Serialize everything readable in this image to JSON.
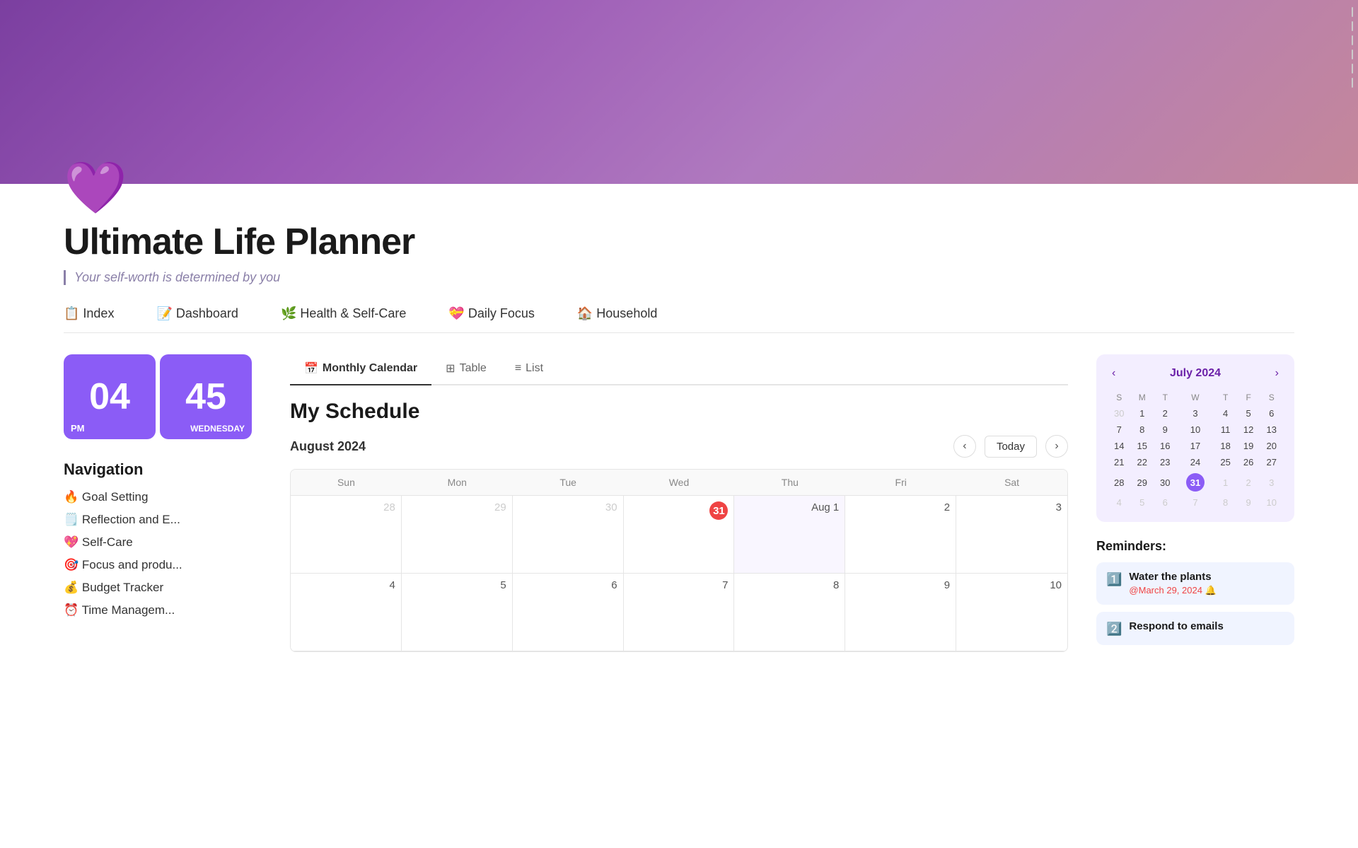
{
  "app": {
    "title": "Ultimate Life Planner",
    "subtitle": "Your self-worth is determined by you",
    "heart_emoji": "💜"
  },
  "nav": {
    "items": [
      {
        "id": "index",
        "label": "📋 Index"
      },
      {
        "id": "dashboard",
        "label": "📝 Dashboard"
      },
      {
        "id": "health",
        "label": "🌿 Health & Self-Care"
      },
      {
        "id": "daily-focus",
        "label": "💝 Daily Focus"
      },
      {
        "id": "household",
        "label": "🏠 Household"
      }
    ]
  },
  "clock": {
    "hour": "04",
    "minute": "45",
    "period": "PM",
    "day": "WEDNESDAY"
  },
  "sidebar_nav": {
    "title": "Navigation",
    "items": [
      {
        "id": "goal-setting",
        "label": "🔥 Goal Setting"
      },
      {
        "id": "reflection",
        "label": "🗒️ Reflection and E..."
      },
      {
        "id": "self-care",
        "label": "💖 Self-Care"
      },
      {
        "id": "focus",
        "label": "🎯 Focus and produ..."
      },
      {
        "id": "budget",
        "label": "💰 Budget Tracker"
      },
      {
        "id": "time",
        "label": "⏰ Time Managem..."
      }
    ]
  },
  "calendar_tabs": [
    {
      "id": "monthly",
      "label": "Monthly Calendar",
      "icon": "📅",
      "active": true
    },
    {
      "id": "table",
      "label": "Table",
      "icon": "⊞",
      "active": false
    },
    {
      "id": "list",
      "label": "List",
      "icon": "≡",
      "active": false
    }
  ],
  "schedule": {
    "title": "My Schedule",
    "month_label": "August 2024",
    "today_button": "Today",
    "weekdays": [
      "Sun",
      "Mon",
      "Tue",
      "Wed",
      "Thu",
      "Fri",
      "Sat"
    ],
    "rows": [
      [
        {
          "num": "28",
          "other": true
        },
        {
          "num": "29",
          "other": true
        },
        {
          "num": "30",
          "other": true
        },
        {
          "num": "31",
          "today": true,
          "other": true
        },
        {
          "num": "Aug 1",
          "highlight": true
        },
        {
          "num": "2"
        },
        {
          "num": "3"
        }
      ],
      [
        {
          "num": "4"
        },
        {
          "num": "5"
        },
        {
          "num": "6"
        },
        {
          "num": "7"
        },
        {
          "num": "8"
        },
        {
          "num": "9"
        },
        {
          "num": "10"
        }
      ]
    ]
  },
  "mini_calendar": {
    "title": "July 2024",
    "weekdays": [
      "S",
      "M",
      "T",
      "W",
      "T",
      "F",
      "S"
    ],
    "rows": [
      [
        {
          "num": "30",
          "other": true
        },
        {
          "num": "1"
        },
        {
          "num": "2"
        },
        {
          "num": "3"
        },
        {
          "num": "4"
        },
        {
          "num": "5"
        },
        {
          "num": "6"
        }
      ],
      [
        {
          "num": "7"
        },
        {
          "num": "8"
        },
        {
          "num": "9"
        },
        {
          "num": "10"
        },
        {
          "num": "11"
        },
        {
          "num": "12"
        },
        {
          "num": "13"
        }
      ],
      [
        {
          "num": "14"
        },
        {
          "num": "15"
        },
        {
          "num": "16"
        },
        {
          "num": "17"
        },
        {
          "num": "18"
        },
        {
          "num": "19"
        },
        {
          "num": "20"
        }
      ],
      [
        {
          "num": "21"
        },
        {
          "num": "22"
        },
        {
          "num": "23"
        },
        {
          "num": "24"
        },
        {
          "num": "25"
        },
        {
          "num": "26"
        },
        {
          "num": "27"
        }
      ],
      [
        {
          "num": "28"
        },
        {
          "num": "29"
        },
        {
          "num": "30"
        },
        {
          "num": "31",
          "today_mini": true
        },
        {
          "num": "1",
          "other": true
        },
        {
          "num": "2",
          "other": true
        },
        {
          "num": "3",
          "other": true
        }
      ],
      [
        {
          "num": "4",
          "other": true
        },
        {
          "num": "5",
          "other": true
        },
        {
          "num": "6",
          "other": true
        },
        {
          "num": "7",
          "other": true
        },
        {
          "num": "8",
          "other": true
        },
        {
          "num": "9",
          "other": true
        },
        {
          "num": "10",
          "other": true
        }
      ]
    ]
  },
  "reminders": {
    "title": "Reminders:",
    "items": [
      {
        "id": "water-plants",
        "title": "Water the plants",
        "date": "@March 29, 2024 🔔",
        "icon": "1️⃣"
      },
      {
        "id": "respond-emails",
        "title": "Respond to emails",
        "date": "",
        "icon": "2️⃣"
      }
    ]
  }
}
